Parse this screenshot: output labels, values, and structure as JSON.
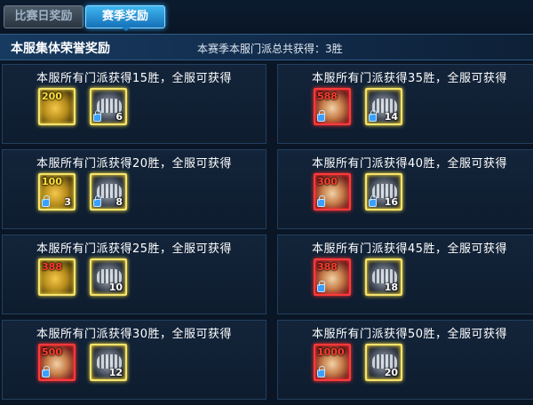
{
  "tabs": {
    "inactive": "比赛日奖励",
    "active": "赛季奖励"
  },
  "header": {
    "title": "本服集体荣誉奖励",
    "stat": "本赛季本服门派总共获得：3胜"
  },
  "cards": [
    {
      "title": "本服所有门派获得15胜，全服可获得",
      "slot1": {
        "value": "200",
        "qty": "",
        "kind": "gold"
      },
      "slot2": {
        "qty": "6"
      }
    },
    {
      "title": "本服所有门派获得35胜，全服可获得",
      "slot1": {
        "value": "588",
        "qty": "",
        "kind": "red"
      },
      "slot2": {
        "qty": "14"
      }
    },
    {
      "title": "本服所有门派获得20胜，全服可获得",
      "slot1": {
        "value": "100",
        "qty": "3",
        "kind": "gold"
      },
      "slot2": {
        "qty": "8"
      }
    },
    {
      "title": "本服所有门派获得40胜，全服可获得",
      "slot1": {
        "value": "300",
        "qty": "",
        "kind": "red"
      },
      "slot2": {
        "qty": "16"
      }
    },
    {
      "title": "本服所有门派获得25胜，全服可获得",
      "slot1": {
        "value": "388",
        "qty": "",
        "kind": "gold"
      },
      "slot2": {
        "qty": "10"
      }
    },
    {
      "title": "本服所有门派获得45胜，全服可获得",
      "slot1": {
        "value": "388",
        "qty": "",
        "kind": "red"
      },
      "slot2": {
        "qty": "18"
      }
    },
    {
      "title": "本服所有门派获得30胜，全服可获得",
      "slot1": {
        "value": "500",
        "qty": "",
        "kind": "red"
      },
      "slot2": {
        "qty": "12"
      }
    },
    {
      "title": "本服所有门派获得50胜，全服可获得",
      "slot1": {
        "value": "1000",
        "qty": "",
        "kind": "red"
      },
      "slot2": {
        "qty": "20"
      }
    }
  ]
}
